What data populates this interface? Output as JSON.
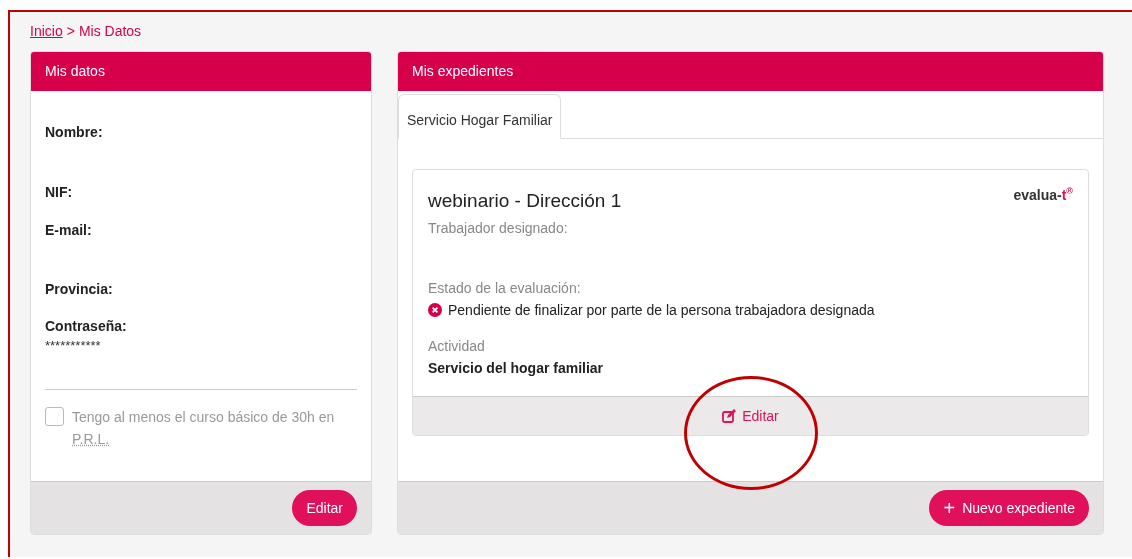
{
  "breadcrumb": {
    "link": "Inicio",
    "separator": ">",
    "current": "Mis Datos"
  },
  "my_data": {
    "title": "Mis datos",
    "fields": [
      {
        "label": "Nombre:"
      },
      {
        "label": "NIF:"
      },
      {
        "label": "E-mail:"
      },
      {
        "label": "Provincia:"
      },
      {
        "label": "Contraseña:",
        "value": "***********"
      }
    ],
    "checkbox": {
      "label": "Tengo al menos el curso básico de 30h en",
      "abbr": "P.R.L.",
      "checked": false
    },
    "button": "Editar"
  },
  "files": {
    "title": "Mis expedientes",
    "tabs": [
      {
        "label": "Servicio Hogar Familiar",
        "selected": true
      }
    ],
    "card": {
      "title": "webinario - Dirección 1",
      "logo": {
        "text": "evalua-",
        "accent": "t",
        "mark": "®"
      },
      "worker_label": "Trabajador designado:",
      "status_label": "Estado de la evaluación:",
      "status": {
        "kind": "error",
        "text": "Pendiente de finalizar por parte de la persona trabajadora designada"
      },
      "activity_label": "Actividad",
      "activity": "Servicio del hogar familiar",
      "edit_button": "Editar"
    },
    "new_button": {
      "icon": "+",
      "label": "Nuevo expediente"
    }
  },
  "annotation": {
    "kind": "circle",
    "color": "#c00000"
  }
}
